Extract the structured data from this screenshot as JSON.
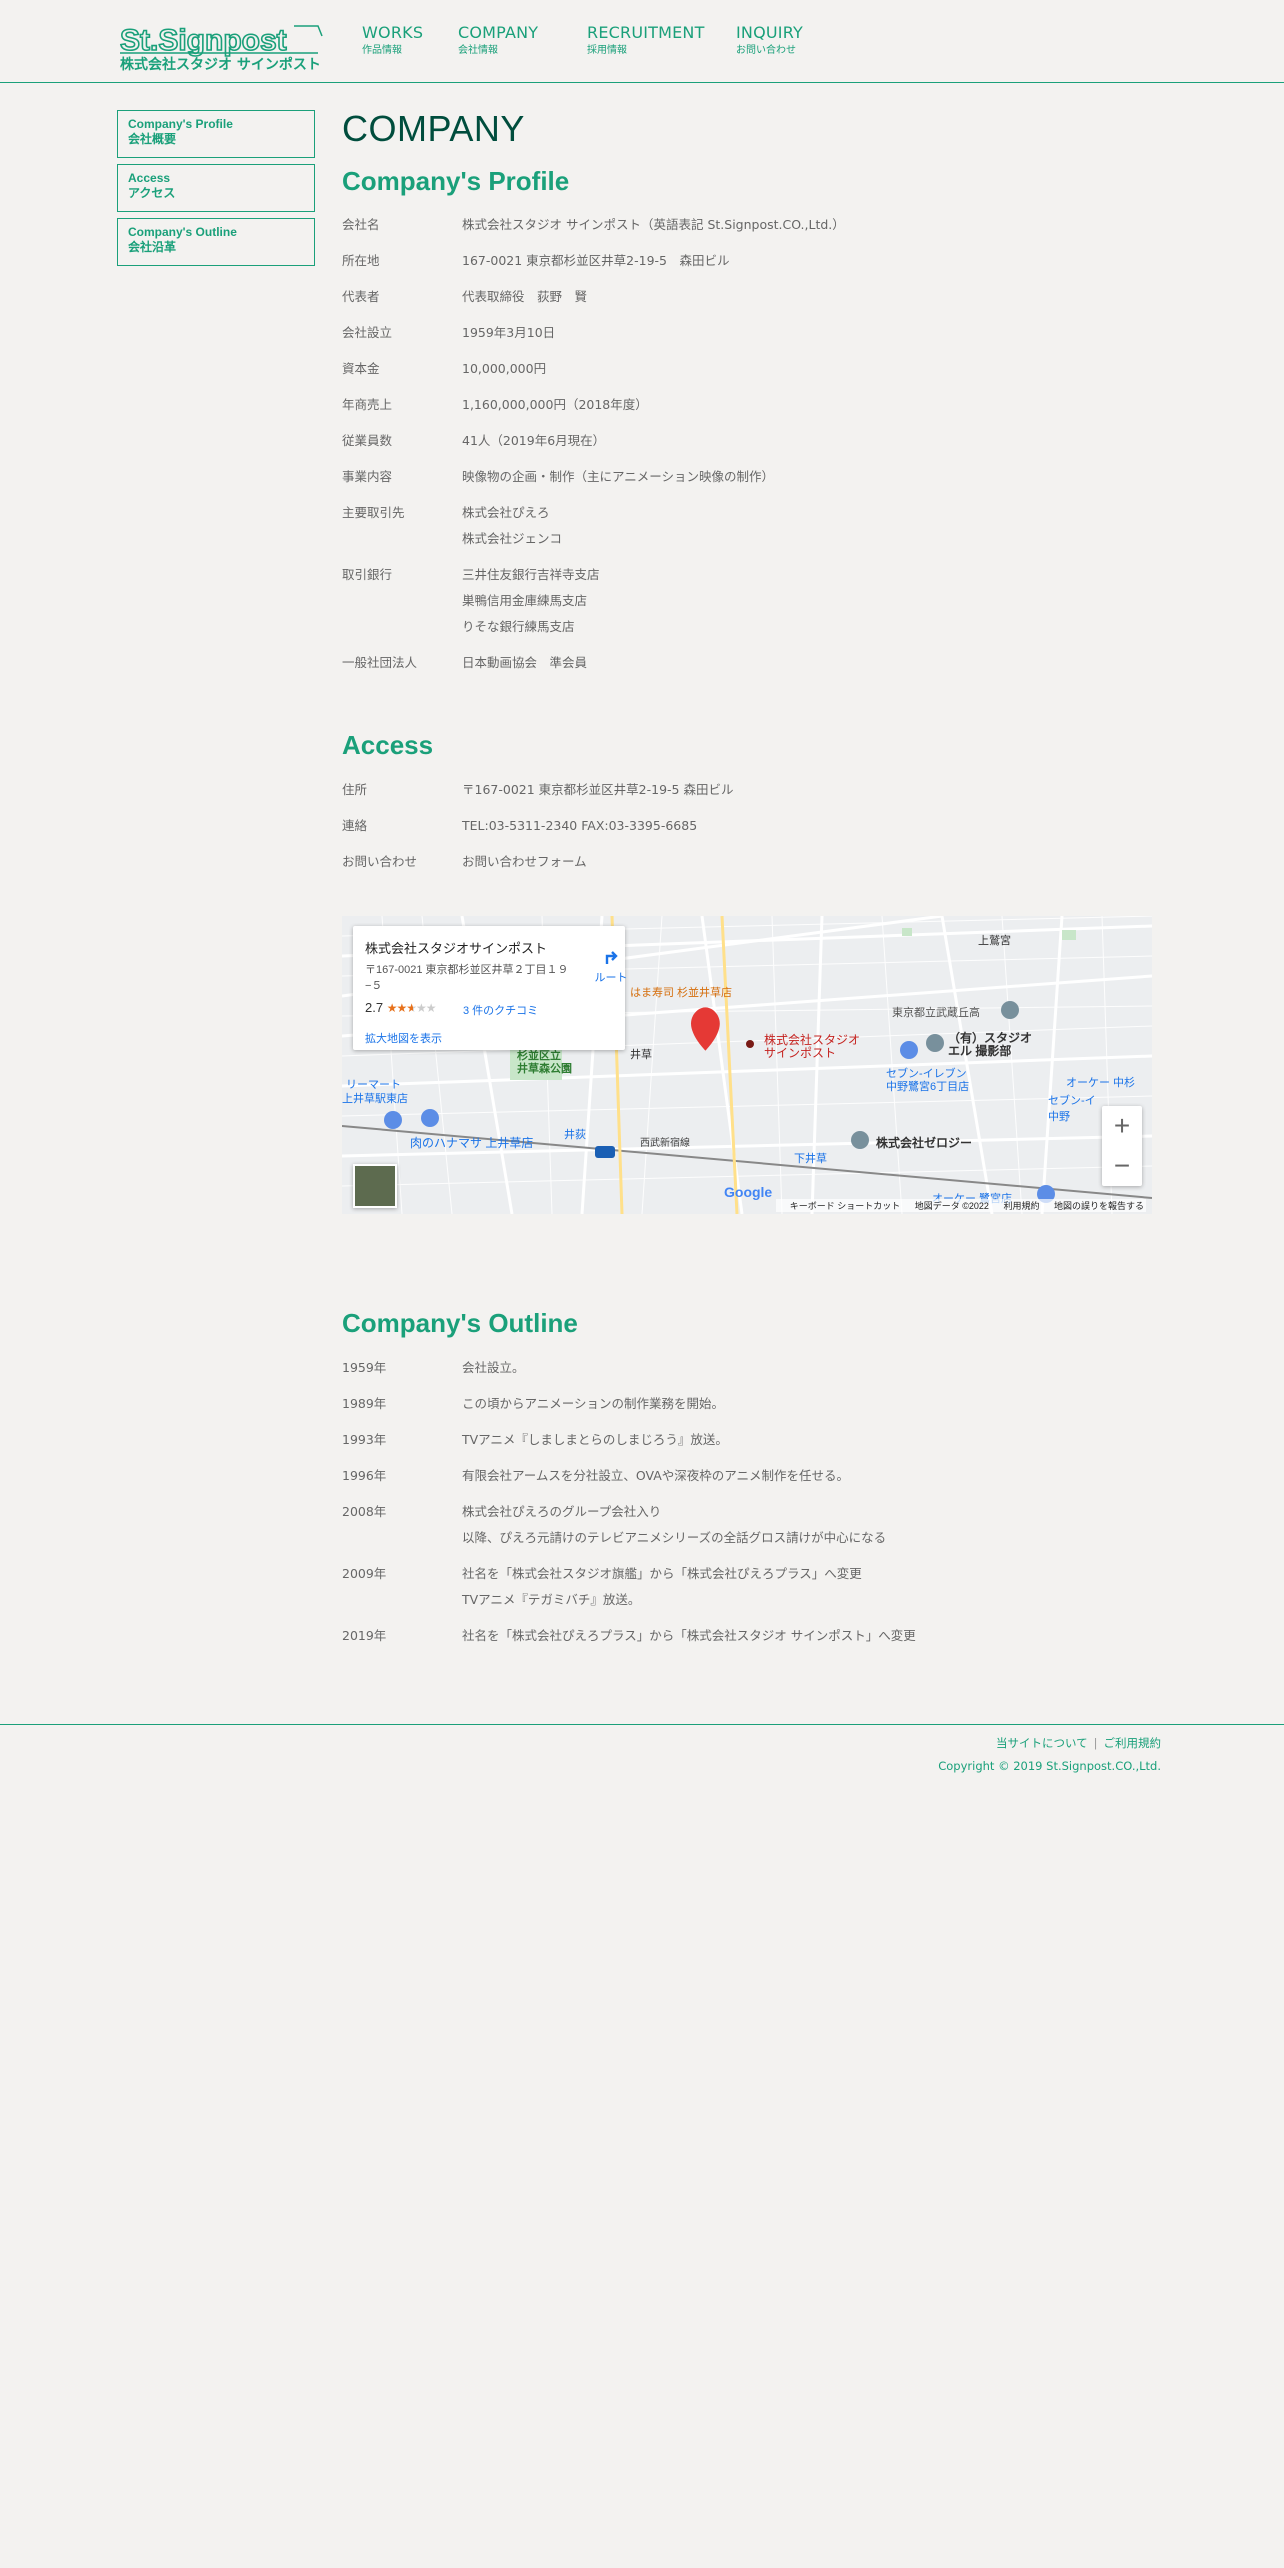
{
  "header": {
    "logo_text_en": "St.Signpost",
    "logo_text_ja": "株式会社スタジオ サインポスト",
    "nav": [
      {
        "en": "WORKS",
        "ja": "作品情報"
      },
      {
        "en": "COMPANY",
        "ja": "会社情報"
      },
      {
        "en": "RECRUITMENT",
        "ja": "採用情報"
      },
      {
        "en": "INQUIRY",
        "ja": "お問い合わせ"
      }
    ]
  },
  "sidebar": [
    {
      "en": "Company's Profile",
      "ja": "会社概要"
    },
    {
      "en": "Access",
      "ja": "アクセス"
    },
    {
      "en": "Company's Outline",
      "ja": "会社沿革"
    }
  ],
  "page_title": "COMPANY",
  "profile": {
    "title": "Company's Profile",
    "rows": [
      {
        "k": "会社名",
        "v": [
          "株式会社スタジオ サインポスト（英語表記 St.Signpost.CO.,Ltd.）"
        ]
      },
      {
        "k": "所在地",
        "v": [
          "167-0021 東京都杉並区井草2-19-5　森田ビル"
        ]
      },
      {
        "k": "代表者",
        "v": [
          "代表取締役　荻野　賢"
        ]
      },
      {
        "k": "会社設立",
        "v": [
          "1959年3月10日"
        ]
      },
      {
        "k": "資本金",
        "v": [
          "10,000,000円"
        ]
      },
      {
        "k": "年商売上",
        "v": [
          "1,160,000,000円（2018年度）"
        ]
      },
      {
        "k": "従業員数",
        "v": [
          "41人（2019年6月現在）"
        ]
      },
      {
        "k": "事業内容",
        "v": [
          "映像物の企画・制作（主にアニメーション映像の制作）"
        ]
      },
      {
        "k": "主要取引先",
        "v": [
          "株式会社ぴえろ",
          "株式会社ジェンコ"
        ]
      },
      {
        "k": "取引銀行",
        "v": [
          "三井住友銀行吉祥寺支店",
          "巣鴨信用金庫練馬支店",
          "りそな銀行練馬支店"
        ]
      },
      {
        "k": "一般社団法人",
        "v": [
          "日本動画協会　準会員"
        ]
      }
    ]
  },
  "access": {
    "title": "Access",
    "rows": [
      {
        "k": "住所",
        "v": [
          "〒167-0021 東京都杉並区井草2-19-5 森田ビル"
        ]
      },
      {
        "k": "連絡",
        "v": [
          "TEL:03-5311-2340 FAX:03-3395-6685"
        ]
      },
      {
        "k": "お問い合わせ",
        "v": [
          "お問い合わせフォーム"
        ]
      }
    ]
  },
  "map": {
    "place_name": "株式会社スタジオサインポスト",
    "address": "〒167-0021 東京都杉並区井草２丁目１９−５",
    "rating": "2.7",
    "stars": 2.7,
    "reviews": "3 件のクチコミ",
    "larger_map": "拡大地図を表示",
    "route": "ルート",
    "zoom_in": "+",
    "zoom_out": "−",
    "google": "Google",
    "footer": [
      "キーボード ショートカット",
      "地図データ ©2022",
      "利用規約",
      "地図の誤りを報告する"
    ],
    "labels": {
      "marker": "株式会社スタジオ\nサインポスト",
      "kamiigusa": "上鷲宮",
      "tokyo_musashigaoka": "東京都立武蔵丘高",
      "el": "（有）スタジオ\nエル 撮影部",
      "seven": "セブン-イレブン\n中野鷺宮6丁目店",
      "park": "杉並区立\n井草森公園",
      "hanamasa": "肉のハナマサ 上井草店",
      "zerology": "株式会社ゼロジー",
      "sushi": "はま寿司 杉並井草店",
      "igusa": "井荻",
      "shimoigusa": "下井草",
      "seibu": "西武新宿線",
      "okay": "オーケー 中杉",
      "okay2": "オーケー 鷺宮店",
      "kamiigusa_st": "上井草駅東店",
      "seven2": "セブン-イ",
      "nakano": "中野",
      "lily": "リーマート",
      "igusa2": "井草"
    }
  },
  "outline": {
    "title": "Company's Outline",
    "rows": [
      {
        "k": "1959年",
        "v": [
          "会社設立。"
        ]
      },
      {
        "k": "1989年",
        "v": [
          "この頃からアニメーションの制作業務を開始。"
        ]
      },
      {
        "k": "1993年",
        "v": [
          "TVアニメ『しましまとらのしまじろう』放送。"
        ]
      },
      {
        "k": "1996年",
        "v": [
          "有限会社アームスを分社設立、OVAや深夜枠のアニメ制作を任せる。"
        ]
      },
      {
        "k": "2008年",
        "v": [
          "株式会社ぴえろのグループ会社入り",
          "以降、ぴえろ元請けのテレビアニメシリーズの全話グロス請けが中心になる"
        ]
      },
      {
        "k": "2009年",
        "v": [
          "社名を「株式会社スタジオ旗艦」から「株式会社ぴえろプラス」へ変更",
          "TVアニメ『テガミバチ』放送。"
        ]
      },
      {
        "k": "2019年",
        "v": [
          "社名を「株式会社ぴえろプラス」から「株式会社スタジオ サインポスト」へ変更"
        ]
      }
    ]
  },
  "footer": {
    "about": "当サイトについて",
    "sep": "|",
    "terms": "ご利用規約",
    "copyright": "Copyright © 2019 St.Signpost.CO.,Ltd."
  },
  "colors": {
    "accent": "#1aa07a",
    "title_dark": "#004d3d",
    "bg": "#f3f2f0"
  }
}
